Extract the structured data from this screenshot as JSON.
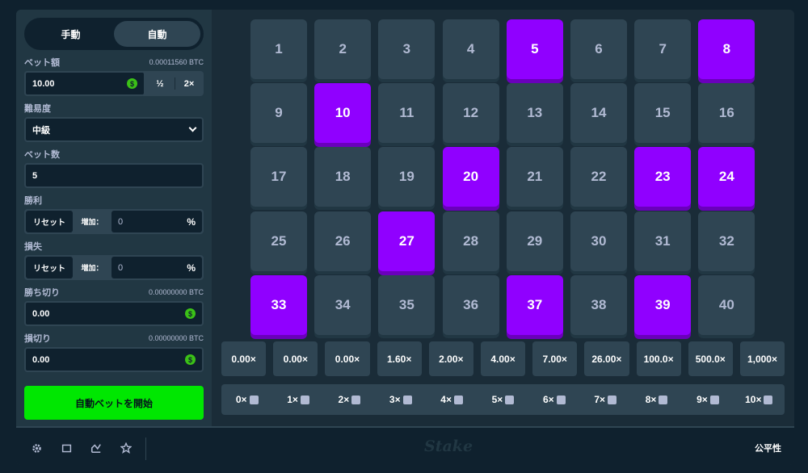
{
  "sidebar": {
    "tabs": [
      {
        "label": "手動",
        "active": false
      },
      {
        "label": "自動",
        "active": true
      }
    ],
    "bet_amount": {
      "label": "ベット額",
      "btc": "0.00011560 BTC",
      "value": "10.00",
      "half": "½",
      "double": "2×"
    },
    "difficulty": {
      "label": "難易度",
      "value": "中級"
    },
    "bet_count": {
      "label": "ベット数",
      "value": "5"
    },
    "on_win": {
      "label": "勝利",
      "reset": "リセット",
      "increase": "増加：",
      "value": "0",
      "unit": "%"
    },
    "on_loss": {
      "label": "損失",
      "reset": "リセット",
      "increase": "増加：",
      "value": "0",
      "unit": "%"
    },
    "stop_profit": {
      "label": "勝ち切り",
      "btc": "0.00000000 BTC",
      "value": "0.00"
    },
    "stop_loss": {
      "label": "損切り",
      "btc": "0.00000000 BTC",
      "value": "0.00"
    },
    "start_label": "自動ベットを開始",
    "coin_symbol": "$"
  },
  "board": {
    "tiles": [
      1,
      2,
      3,
      4,
      5,
      6,
      7,
      8,
      9,
      10,
      11,
      12,
      13,
      14,
      15,
      16,
      17,
      18,
      19,
      20,
      21,
      22,
      23,
      24,
      25,
      26,
      27,
      28,
      29,
      30,
      31,
      32,
      33,
      34,
      35,
      36,
      37,
      38,
      39,
      40
    ],
    "selected": [
      5,
      8,
      10,
      20,
      23,
      24,
      27,
      33,
      37,
      39
    ],
    "colors": {
      "tile": "#2f4553",
      "selected": "#9000ff",
      "accent_green": "#00e701"
    }
  },
  "payouts": [
    "0.00×",
    "0.00×",
    "0.00×",
    "1.60×",
    "2.00×",
    "4.00×",
    "7.00×",
    "26.00×",
    "100.0×",
    "500.0×",
    "1,000×"
  ],
  "hits": [
    "0×",
    "1×",
    "2×",
    "3×",
    "4×",
    "5×",
    "6×",
    "7×",
    "8×",
    "9×",
    "10×"
  ],
  "footer": {
    "icons": [
      "gear-icon",
      "square-icon",
      "chart-icon",
      "star-icon"
    ],
    "logo": "Stake",
    "fairness": "公平性"
  }
}
